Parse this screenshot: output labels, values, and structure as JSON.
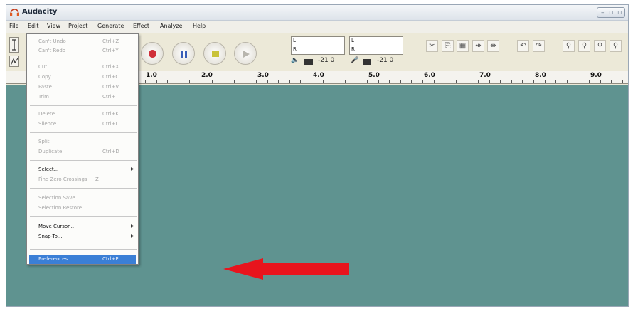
{
  "app": {
    "title": "Audacity"
  },
  "menubar": [
    "File",
    "Edit",
    "View",
    "Project",
    "Generate",
    "Effect",
    "Analyze",
    "Help"
  ],
  "meters": {
    "play_label": "-21  0",
    "record_label": "-21  0",
    "play_channels": [
      "L",
      "R"
    ],
    "record_channels": [
      "L",
      "R"
    ]
  },
  "ruler": {
    "ticks": [
      "1.0",
      "2.0",
      "3.0",
      "4.0",
      "5.0",
      "6.0",
      "7.0",
      "8.0",
      "9.0"
    ]
  },
  "edit_menu": {
    "items": [
      {
        "label": "Can't Undo",
        "shortcut": "Ctrl+Z"
      },
      {
        "label": "Can't Redo",
        "shortcut": "Ctrl+Y"
      },
      {
        "label": "Cut",
        "shortcut": "Ctrl+X"
      },
      {
        "label": "Copy",
        "shortcut": "Ctrl+C"
      },
      {
        "label": "Paste",
        "shortcut": "Ctrl+V"
      },
      {
        "label": "Trim",
        "shortcut": "Ctrl+T"
      },
      {
        "label": "Delete",
        "shortcut": "Ctrl+K"
      },
      {
        "label": "Silence",
        "shortcut": "Ctrl+L"
      },
      {
        "label": "Split",
        "shortcut": ""
      },
      {
        "label": "Duplicate",
        "shortcut": "Ctrl+D"
      },
      {
        "label": "Select...",
        "shortcut": ""
      },
      {
        "label": "Find Zero Crossings",
        "shortcut": "Z"
      },
      {
        "label": "Selection Save",
        "shortcut": ""
      },
      {
        "label": "Selection Restore",
        "shortcut": ""
      },
      {
        "label": "Move Cursor...",
        "shortcut": ""
      },
      {
        "label": "Snap-To...",
        "shortcut": ""
      },
      {
        "label": "Preferences...",
        "shortcut": "Ctrl+P"
      }
    ]
  },
  "colors": {
    "track_area": "#5f9390",
    "arrow": "#e8141d",
    "highlight": "#3b7fd6"
  }
}
